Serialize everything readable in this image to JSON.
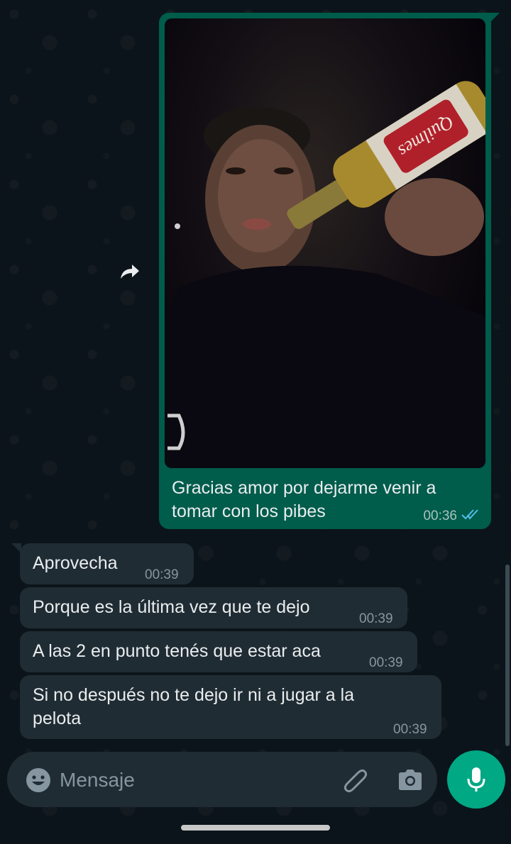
{
  "chat": {
    "outgoing": {
      "caption": "Gracias amor por dejarme venir a tomar con los pibes",
      "time": "00:36",
      "status": "read",
      "photo_label": "Quilmes"
    },
    "incoming": [
      {
        "text": "Aprovecha",
        "time": "00:39"
      },
      {
        "text": "Porque es la última vez que te dejo",
        "time": "00:39"
      },
      {
        "text": "A las 2 en punto tenés que estar aca",
        "time": "00:39"
      },
      {
        "text": "Si no después no te dejo ir ni a jugar a la pelota",
        "time": "00:39"
      }
    ]
  },
  "composer": {
    "placeholder": "Mensaje"
  },
  "icons": {
    "forward": "forward-icon",
    "emoji": "emoji-icon",
    "attach": "paperclip-icon",
    "camera": "camera-icon",
    "mic": "microphone-icon"
  },
  "colors": {
    "background": "#0b141a",
    "outgoing_bubble": "#005c4b",
    "incoming_bubble": "#202c33",
    "accent": "#00a884",
    "read_ticks": "#53bdeb"
  }
}
